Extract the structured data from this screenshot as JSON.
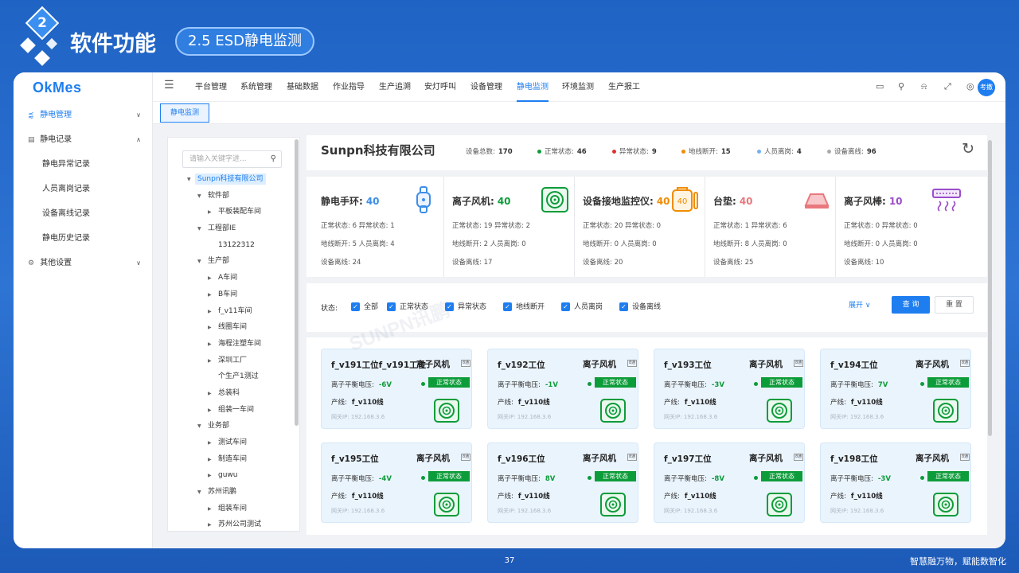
{
  "slide": {
    "badge_number": "2",
    "title": "软件功能",
    "section": "2.5 ESD静电监测",
    "page_number": "37",
    "slogan": "智慧融万物，赋能数智化"
  },
  "app": {
    "logo": "OkMes",
    "sidebar": {
      "items": [
        {
          "label": "静电管理",
          "icon": "share-icon",
          "expanded": false,
          "active": true
        },
        {
          "label": "静电记录",
          "icon": "calendar-icon",
          "expanded": true,
          "active": false
        },
        {
          "label": "其他设置",
          "icon": "gear-icon",
          "expanded": false,
          "active": false
        }
      ],
      "sub_items": [
        "静电异常记录",
        "人员离岗记录",
        "设备离线记录",
        "静电历史记录"
      ]
    },
    "topnav": {
      "items": [
        "平台管理",
        "系统管理",
        "基础数据",
        "作业指导",
        "生产追溯",
        "安灯呼叫",
        "设备管理",
        "静电监测",
        "环境监测",
        "生产报工"
      ],
      "active": "静电监测",
      "avatar": "考撒"
    },
    "tab": "静电监测",
    "tree": {
      "search_placeholder": "请输入关键字进...",
      "nodes": [
        {
          "label": "Sunpn科技有限公司",
          "level": 0,
          "arrow": "down",
          "selected": true
        },
        {
          "label": "软件部",
          "level": 1,
          "arrow": "down"
        },
        {
          "label": "平板装配车间",
          "level": 2,
          "arrow": "right"
        },
        {
          "label": "工程部IE",
          "level": 1,
          "arrow": "down"
        },
        {
          "label": "13122312",
          "level": 2,
          "arrow": ""
        },
        {
          "label": "生产部",
          "level": 1,
          "arrow": "down"
        },
        {
          "label": "A车间",
          "level": 2,
          "arrow": "right"
        },
        {
          "label": "B车间",
          "level": 2,
          "arrow": "right"
        },
        {
          "label": "f_v11车间",
          "level": 2,
          "arrow": "right"
        },
        {
          "label": "线圈车间",
          "level": 2,
          "arrow": "right"
        },
        {
          "label": "海程注塑车间",
          "level": 2,
          "arrow": "right"
        },
        {
          "label": "深圳工厂",
          "level": 2,
          "arrow": "right"
        },
        {
          "label": "个生产1测过",
          "level": 2,
          "arrow": ""
        },
        {
          "label": "总装科",
          "level": 2,
          "arrow": "right"
        },
        {
          "label": "组装一车间",
          "level": 2,
          "arrow": "right"
        },
        {
          "label": "业务部",
          "level": 1,
          "arrow": "down"
        },
        {
          "label": "测试车间",
          "level": 2,
          "arrow": "right"
        },
        {
          "label": "制造车间",
          "level": 2,
          "arrow": "right"
        },
        {
          "label": "guwu",
          "level": 2,
          "arrow": "right"
        },
        {
          "label": "苏州讯鹏",
          "level": 1,
          "arrow": "down"
        },
        {
          "label": "组装车间",
          "level": 2,
          "arrow": "right"
        },
        {
          "label": "苏州公司测试",
          "level": 2,
          "arrow": "right"
        }
      ]
    },
    "summary": {
      "company": "Sunpn科技有限公司",
      "stats": [
        {
          "label": "设备总数:",
          "value": "170",
          "color": ""
        },
        {
          "label": "正常状态:",
          "value": "46",
          "color": "#0d9c3a"
        },
        {
          "label": "异常状态:",
          "value": "9",
          "color": "#e03131"
        },
        {
          "label": "地线断开:",
          "value": "15",
          "color": "#f08c00"
        },
        {
          "label": "人员离岗:",
          "value": "4",
          "color": "#74b0f0"
        },
        {
          "label": "设备离线:",
          "value": "96",
          "color": "#aaaaaa"
        }
      ]
    },
    "devices": [
      {
        "name": "静电手环:",
        "count": "40",
        "color": "#3d8ee8",
        "icon": "wristband-icon",
        "lines": [
          "正常状态: 6   异常状态: 1",
          "地线断开: 5   人员离岗: 4",
          "设备离线: 24"
        ]
      },
      {
        "name": "离子风机:",
        "count": "40",
        "color": "#0d9c3a",
        "icon": "ion-fan-icon",
        "lines": [
          "正常状态: 19  异常状态: 2",
          "地线断开: 2   人员离岗: 0",
          "设备离线: 17"
        ]
      },
      {
        "name": "设备接地监控仪:",
        "count": "40",
        "color": "#f08c00",
        "icon": "ground-monitor-icon",
        "lines": [
          "正常状态: 20  异常状态: 0",
          "地线断开: 0   人员离岗: 0",
          "设备离线: 20"
        ]
      },
      {
        "name": "台垫:",
        "count": "40",
        "color": "#e8787c",
        "icon": "mat-icon",
        "lines": [
          "正常状态: 1   异常状态: 6",
          "地线断开: 8   人员离岗: 0",
          "设备离线: 25"
        ]
      },
      {
        "name": "离子风棒:",
        "count": "10",
        "color": "#9b4dca",
        "icon": "ion-bar-icon",
        "lines": [
          "正常状态: 0   异常状态: 0",
          "地线断开: 0   人员离岗: 0",
          "设备离线: 10"
        ]
      }
    ],
    "filter": {
      "label": "状态:",
      "options": [
        "全部",
        "正常状态",
        "异常状态",
        "地线断开",
        "人员离岗",
        "设备离线"
      ],
      "expand": "展开",
      "query": "查 询",
      "reset": "重 置"
    },
    "cards": [
      {
        "title": "f_v191工位f_v191工位",
        "type": "离子风机",
        "voltage": "-6V",
        "status": "正常状态",
        "line": "f_v110线",
        "ip": "网关IP: 192.168.3.6"
      },
      {
        "title": "f_v192工位",
        "type": "离子风机",
        "voltage": "-1V",
        "status": "正常状态",
        "line": "f_v110线",
        "ip": "网关IP: 192.168.3.6"
      },
      {
        "title": "f_v193工位",
        "type": "离子风机",
        "voltage": "-3V",
        "status": "正常状态",
        "line": "f_v110线",
        "ip": "网关IP: 192.168.3.6"
      },
      {
        "title": "f_v194工位",
        "type": "离子风机",
        "voltage": "7V",
        "status": "正常状态",
        "line": "f_v110线",
        "ip": "网关IP: 192.168.3.6"
      },
      {
        "title": "f_v195工位",
        "type": "离子风机",
        "voltage": "-4V",
        "status": "正常状态",
        "line": "f_v110线",
        "ip": "网关IP: 192.168.3.6"
      },
      {
        "title": "f_v196工位",
        "type": "离子风机",
        "voltage": "8V",
        "status": "正常状态",
        "line": "f_v110线",
        "ip": "网关IP: 192.168.3.6"
      },
      {
        "title": "f_v197工位",
        "type": "离子风机",
        "voltage": "-8V",
        "status": "正常状态",
        "line": "f_v110线",
        "ip": "网关IP: 192.168.3.6"
      },
      {
        "title": "f_v198工位",
        "type": "离子风机",
        "voltage": "-3V",
        "status": "正常状态",
        "line": "f_v110线",
        "ip": "网关IP: 192.168.3.6"
      }
    ],
    "card_labels": {
      "voltage": "离子平衡电压:",
      "line": "产线:",
      "tag": "8通"
    },
    "watermark": "SUNPN讯鹏"
  }
}
